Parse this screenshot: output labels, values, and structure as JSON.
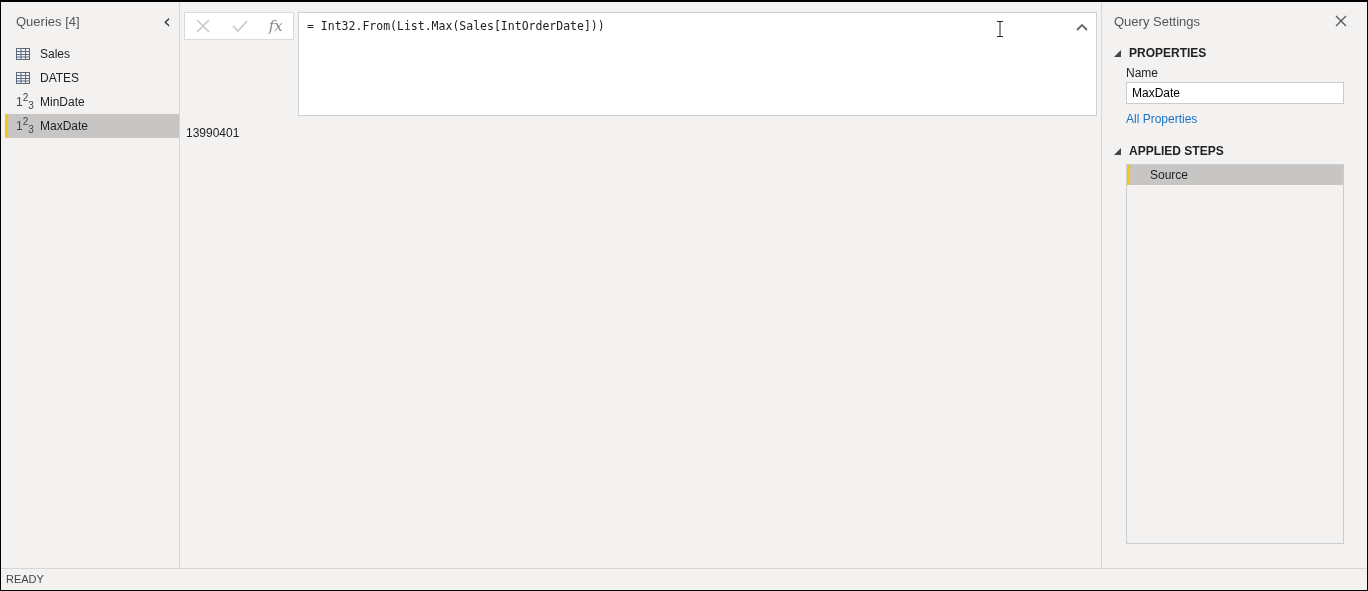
{
  "queries_pane": {
    "title": "Queries [4]",
    "collapse_glyph": "‹",
    "items": [
      {
        "kind": "table",
        "label": "Sales",
        "selected": false
      },
      {
        "kind": "table",
        "label": "DATES",
        "selected": false
      },
      {
        "kind": "number",
        "glyph": "1$^{2}$$_{3}$",
        "label": "MinDate",
        "selected": false
      },
      {
        "kind": "number",
        "glyph": "1$^{2}$$_{3}$",
        "label": "MaxDate",
        "selected": true
      }
    ]
  },
  "formula_bar": {
    "fx": "fx",
    "formula": "= Int32.From(List.Max(Sales[IntOrderDate]))"
  },
  "result": "13990401",
  "query_settings": {
    "title": "Query Settings",
    "properties_heading": "PROPERTIES",
    "name_label": "Name",
    "name_value": "MaxDate",
    "all_properties": "All Properties",
    "steps_heading": "APPLIED STEPS",
    "steps": [
      {
        "label": "Source",
        "selected": true
      }
    ]
  },
  "status_bar": "READY"
}
